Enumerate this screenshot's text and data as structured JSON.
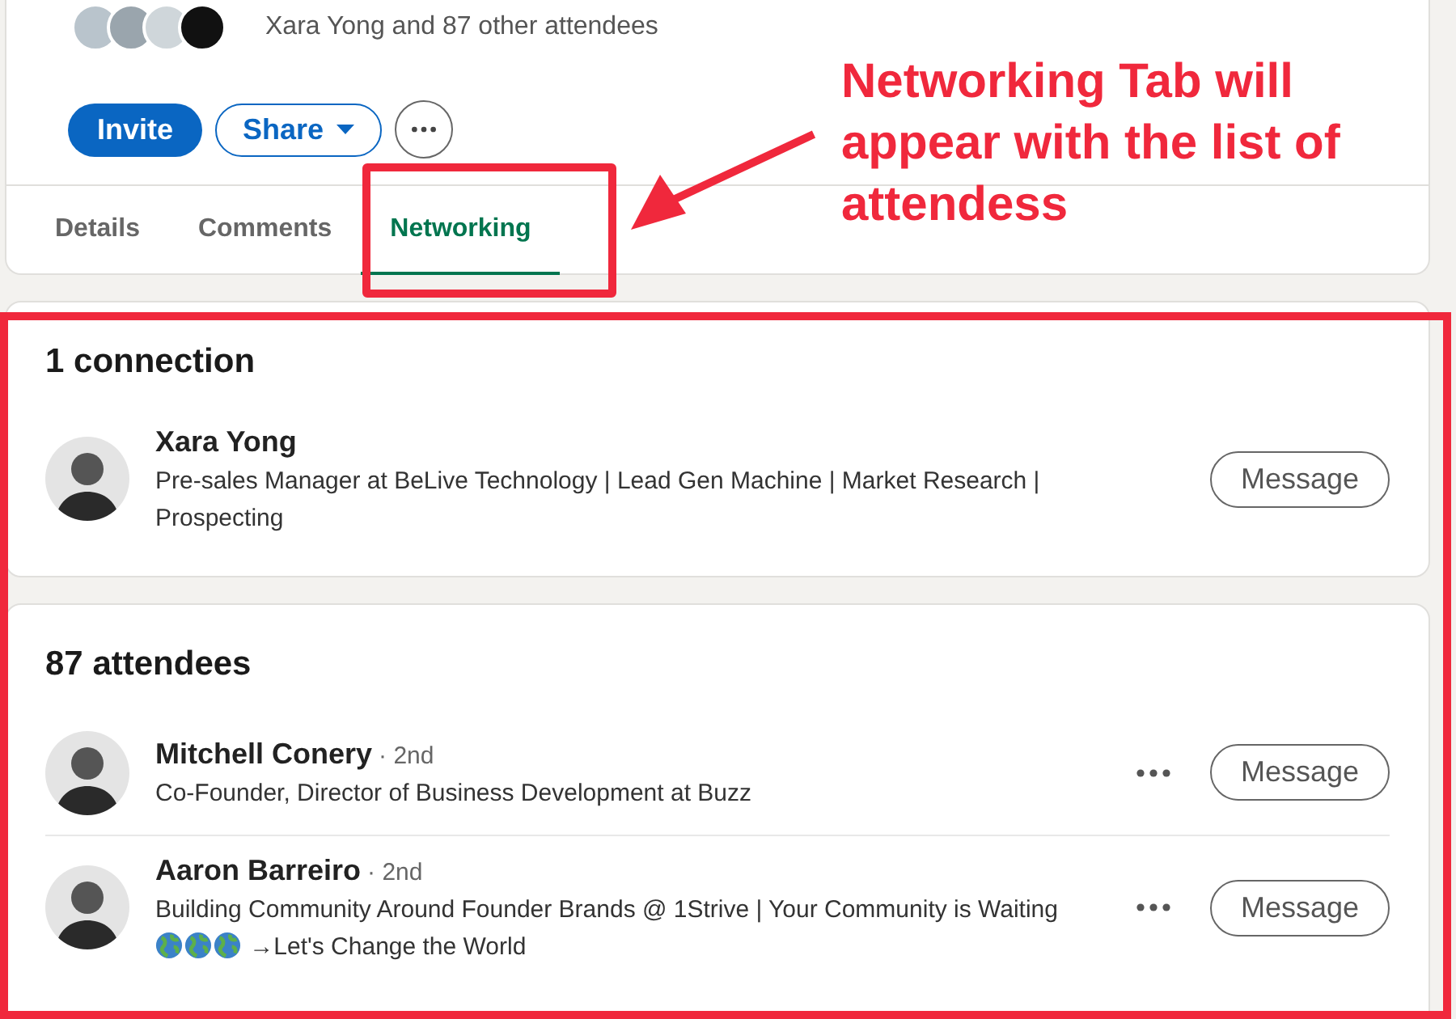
{
  "event": {
    "attendees_text": "Xara Yong and 87 other attendees",
    "invite_button": "Invite",
    "share_button": "Share"
  },
  "tabs": [
    {
      "label": "Details",
      "selected": false
    },
    {
      "label": "Comments",
      "selected": false
    },
    {
      "label": "Networking",
      "selected": true
    }
  ],
  "connections": {
    "title": "1 connection",
    "people": [
      {
        "name": "Xara Yong",
        "headline": "Pre-sales Manager at BeLive Technology | Lead Gen Machine | Market Research | Prospecting",
        "button": "Message"
      }
    ]
  },
  "attendees": {
    "title": "87 attendees",
    "people": [
      {
        "name": "Mitchell Conery",
        "degree": "· 2nd",
        "headline": "Co-Founder, Director of Business Development at Buzz",
        "button": "Message"
      },
      {
        "name": "Aaron Barreiro",
        "degree": "· 2nd",
        "headline": "Building Community Around Founder Brands @ 1Strive | Your Community is Waiting",
        "headline_suffix": "→Let's Change the World",
        "button": "Message"
      }
    ]
  },
  "annotation": {
    "text": "Networking Tab will appear with the list of attendess"
  }
}
